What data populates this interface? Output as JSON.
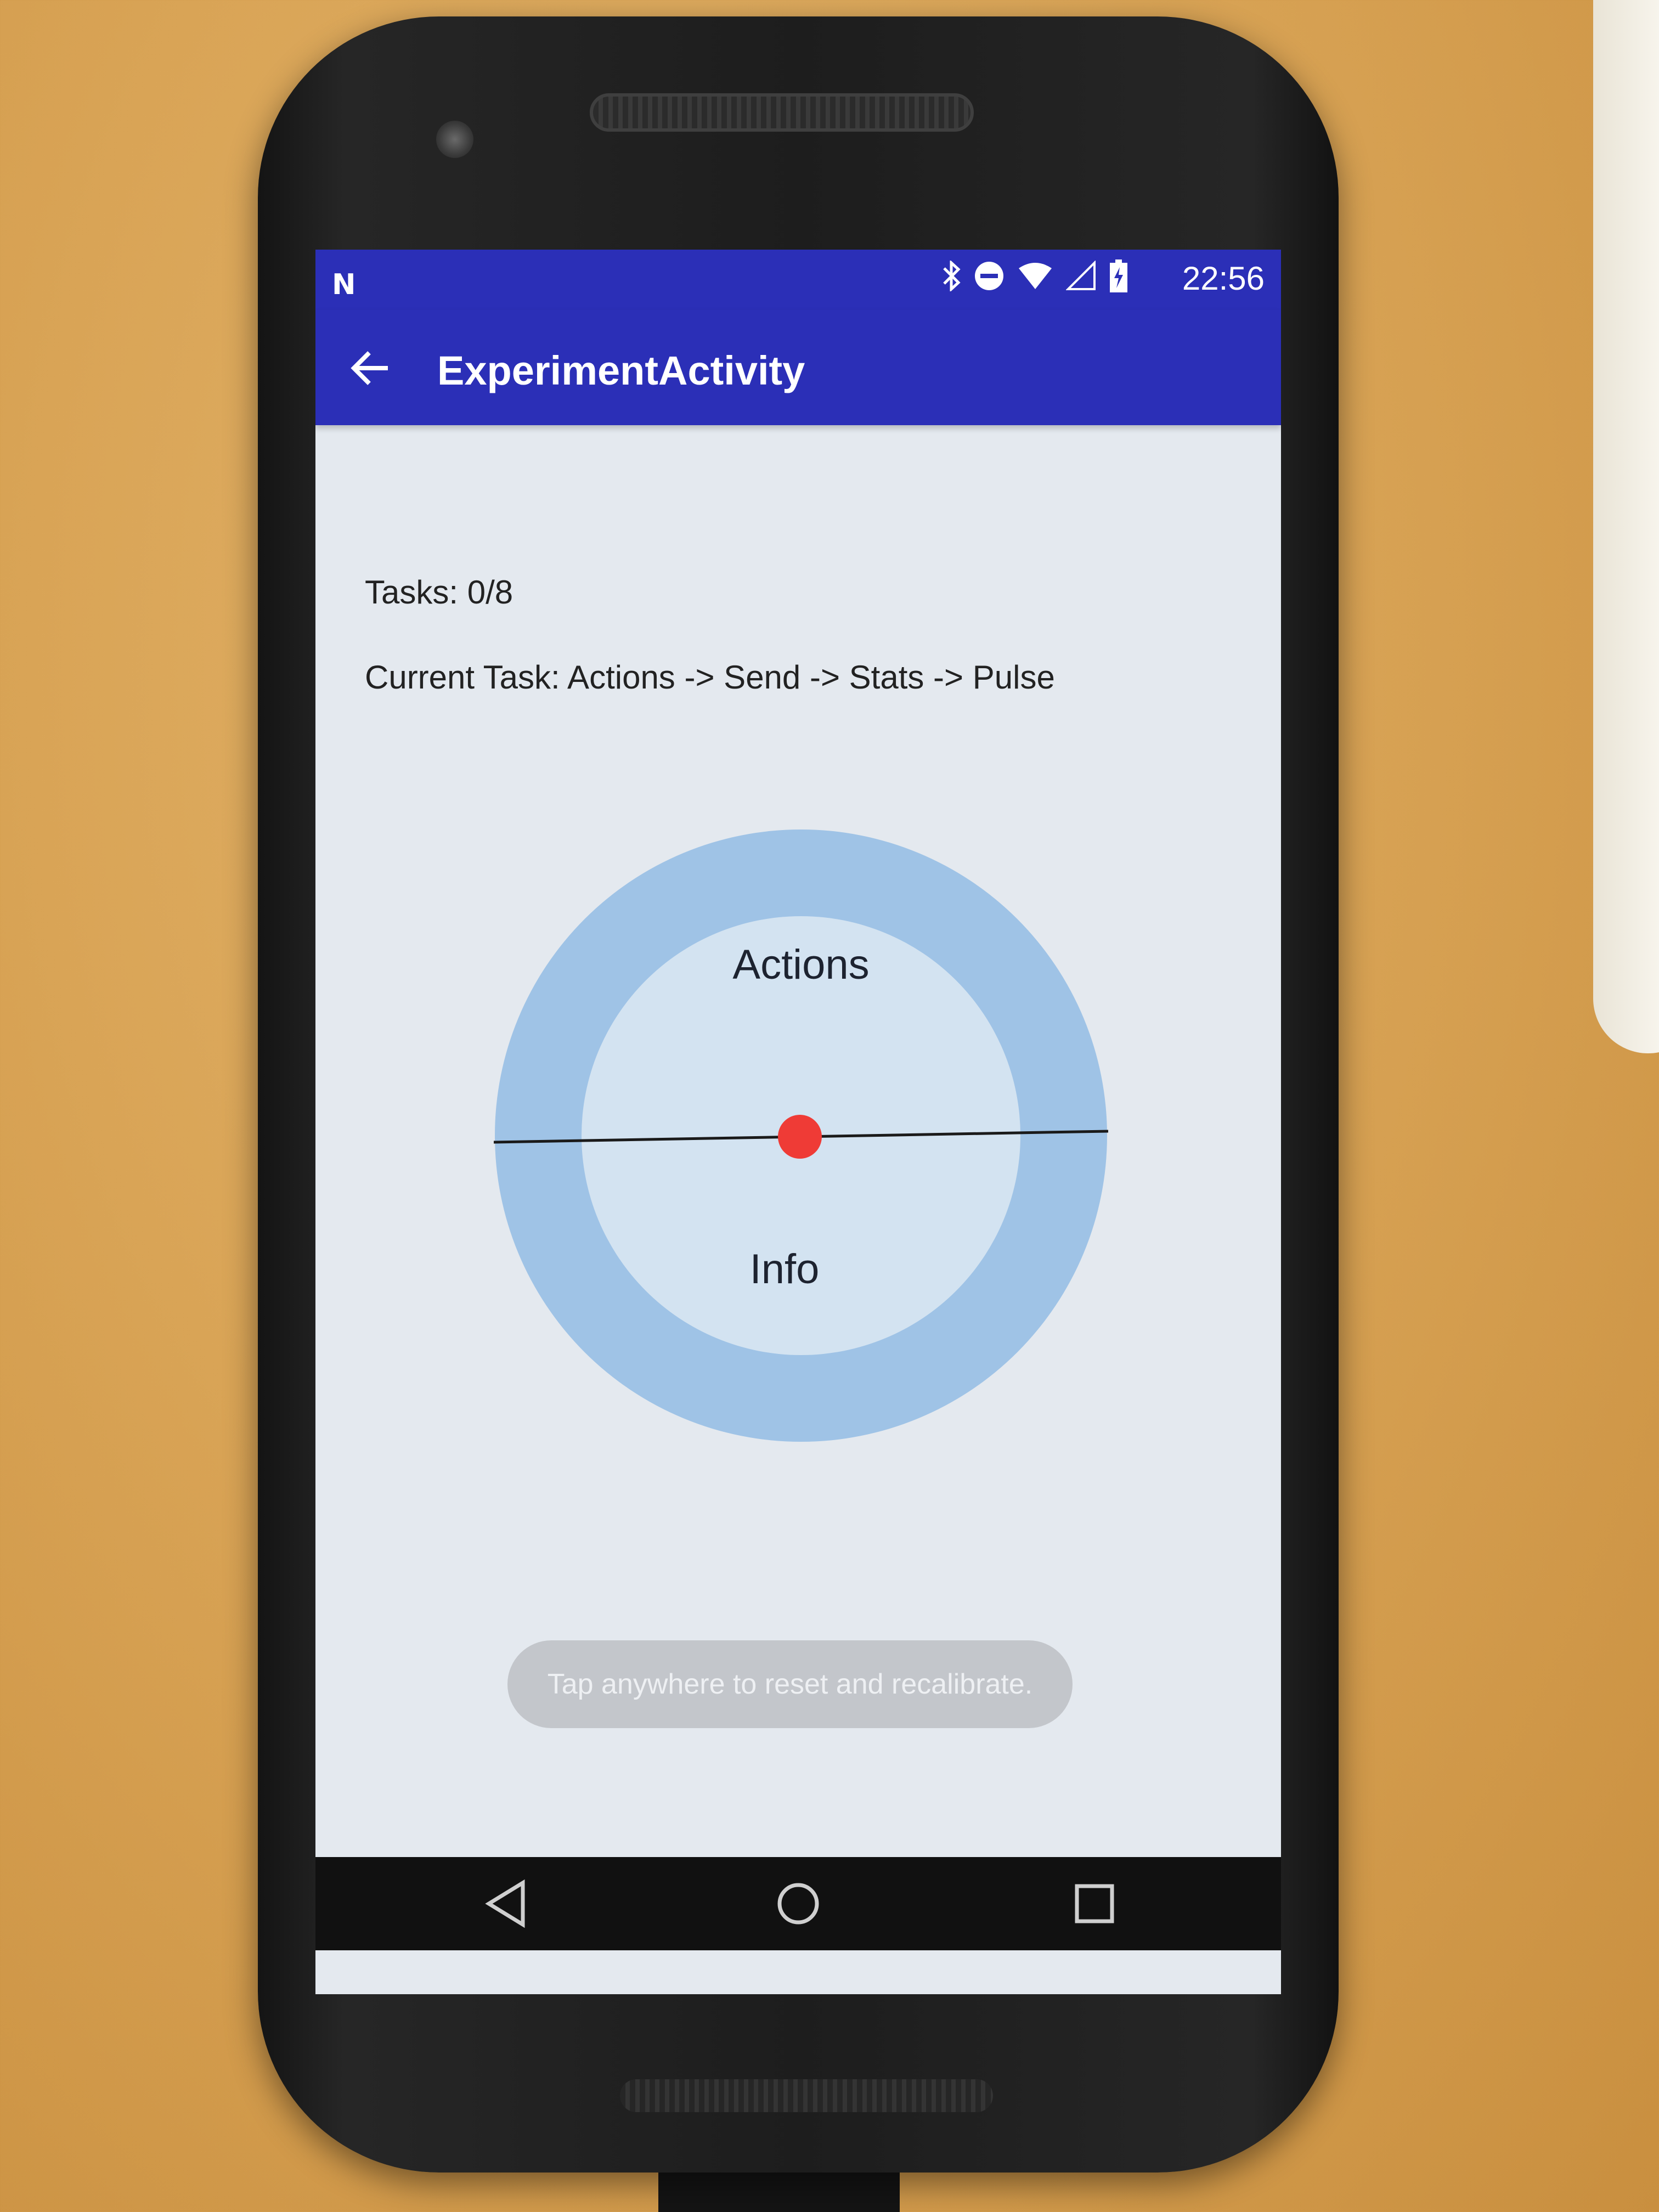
{
  "status_bar": {
    "notification_icon": "N",
    "icons": [
      "bluetooth-icon",
      "do-not-disturb-icon",
      "wifi-icon",
      "signal-icon",
      "battery-charging-icon"
    ],
    "time": "22:56"
  },
  "app_bar": {
    "back_icon": "arrow-back-icon",
    "title": "ExperimentActivity",
    "color": "#2b2fb7"
  },
  "main": {
    "tasks_label": "Tasks: 0/8",
    "current_task": "Current Task: Actions -> Send -> Stats -> Pulse"
  },
  "dial": {
    "top_label": "Actions",
    "bottom_label": "Info",
    "outer_ring_color": "#9fc3e6",
    "inner_circle_color": "#d3e3f1",
    "pointer_color": "#ef3b36"
  },
  "toast": {
    "message": "Tap anywhere to reset and recalibrate."
  },
  "nav_bar": {
    "buttons": [
      "back-triangle-icon",
      "home-circle-icon",
      "recents-square-icon"
    ]
  }
}
